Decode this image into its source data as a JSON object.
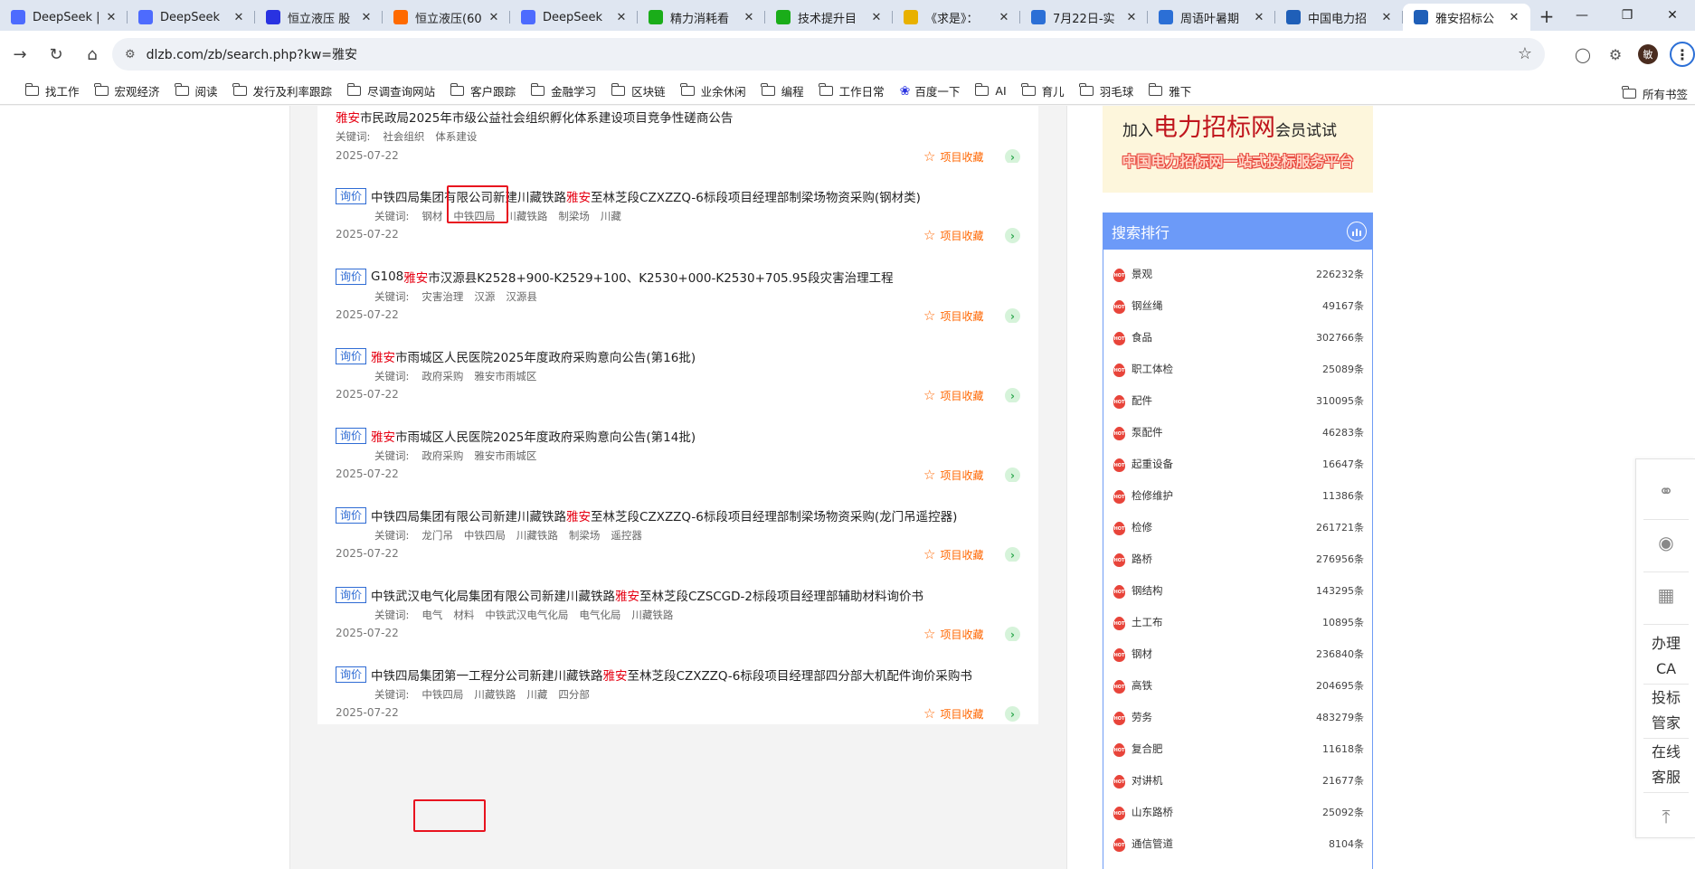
{
  "browser": {
    "tabs": [
      {
        "title": "DeepSeek |",
        "icon": "deepseek-icon",
        "color": "#4d6bfe"
      },
      {
        "title": "DeepSeek",
        "icon": "deepseek-icon",
        "color": "#4d6bfe"
      },
      {
        "title": "恒立液压 股",
        "icon": "baidu-paw-icon",
        "color": "#2932e1"
      },
      {
        "title": "恒立液压(60",
        "icon": "flame-icon",
        "color": "#ff6a00"
      },
      {
        "title": "DeepSeek",
        "icon": "deepseek-icon",
        "color": "#4d6bfe"
      },
      {
        "title": "精力消耗看",
        "icon": "sheet-icon",
        "color": "#1aad19"
      },
      {
        "title": "技术提升目",
        "icon": "sheet-icon",
        "color": "#1aad19"
      },
      {
        "title": "《求是》：",
        "icon": "s-logo-icon",
        "color": "#e8b100"
      },
      {
        "title": "7月22日-实",
        "icon": "doc-icon",
        "color": "#2b6fd6"
      },
      {
        "title": "周语叶暑期",
        "icon": "doc-icon",
        "color": "#2b6fd6"
      },
      {
        "title": "中国电力招",
        "icon": "dlzb-icon",
        "color": "#1f5fb8"
      },
      {
        "title": "雅安招标公",
        "icon": "dlzb-icon",
        "color": "#1f5fb8",
        "active": true
      }
    ],
    "url": "dlzb.com/zb/search.php?kw=雅安",
    "avatar_letter": "敏",
    "bookmarks": [
      "找工作",
      "宏观经济",
      "阅读",
      "发行及利率跟踪",
      "尽调查询网站",
      "客户跟踪",
      "金融学习",
      "区块链",
      "业余休闲",
      "编程",
      "工作日常",
      "百度一下",
      "AI",
      "育儿",
      "羽毛球",
      "雅下"
    ],
    "bookmarks_right": "所有书签"
  },
  "results": {
    "keyword_label": "关键词:",
    "favorite_label": "项目收藏",
    "items": [
      {
        "badge": "",
        "pre": "",
        "hl": "雅安",
        "post": "市民政局2025年市级公益社会组织孵化体系建设项目竞争性磋商公告",
        "keywords": [
          "社会组织",
          "体系建设"
        ],
        "date": "2025-07-22"
      },
      {
        "badge": "询价",
        "pre": "中铁四局集团有限公司新建川藏铁路",
        "hl": "雅安",
        "post": "至林芝段CZXZZQ-6标段项目经理部制梁场物资采购(钢材类)",
        "keywords": [
          "钢材",
          "中铁四局",
          "川藏铁路",
          "制梁场",
          "川藏"
        ],
        "date": "2025-07-22"
      },
      {
        "badge": "询价",
        "pre": "G108",
        "hl": "雅安",
        "post": "市汉源县K2528+900-K2529+100、K2530+000-K2530+705.95段灾害治理工程",
        "keywords": [
          "灾害治理",
          "汉源",
          "汉源县"
        ],
        "date": "2025-07-22"
      },
      {
        "badge": "询价",
        "pre": "",
        "hl": "雅安",
        "post": "市雨城区人民医院2025年度政府采购意向公告(第16批)",
        "keywords": [
          "政府采购",
          "雅安市雨城区"
        ],
        "date": "2025-07-22"
      },
      {
        "badge": "询价",
        "pre": "",
        "hl": "雅安",
        "post": "市雨城区人民医院2025年度政府采购意向公告(第14批)",
        "keywords": [
          "政府采购",
          "雅安市雨城区"
        ],
        "date": "2025-07-22"
      },
      {
        "badge": "询价",
        "pre": "中铁四局集团有限公司新建川藏铁路",
        "hl": "雅安",
        "post": "至林芝段CZXZZQ-6标段项目经理部制梁场物资采购(龙门吊遥控器)",
        "keywords": [
          "龙门吊",
          "中铁四局",
          "川藏铁路",
          "制梁场",
          "遥控器"
        ],
        "date": "2025-07-22"
      },
      {
        "badge": "询价",
        "pre": "中铁武汉电气化局集团有限公司新建川藏铁路",
        "hl": "雅安",
        "post": "至林芝段CZSCGD-2标段项目经理部辅助材料询价书",
        "keywords": [
          "电气",
          "材料",
          "中铁武汉电气化局",
          "电气化局",
          "川藏铁路"
        ],
        "date": "2025-07-22"
      },
      {
        "badge": "询价",
        "pre": "中铁四局集团第一工程分公司新建川藏铁路",
        "hl": "雅安",
        "post": "至林芝段CZXZZQ-6标段项目经理部四分部大机配件询价采购书",
        "keywords": [
          "中铁四局",
          "川藏铁路",
          "川藏",
          "四分部"
        ],
        "date": "2025-07-22"
      }
    ]
  },
  "banner": {
    "line1_pre": "加入",
    "line1_big": "电力招标网",
    "line1_post": "会员试试",
    "line2": "中国电力招标网一站式投标服务平台"
  },
  "ranking": {
    "title": "搜索排行",
    "items": [
      {
        "name": "景观",
        "count": "226232条"
      },
      {
        "name": "钢丝绳",
        "count": "49167条"
      },
      {
        "name": "食品",
        "count": "302766条"
      },
      {
        "name": "职工体检",
        "count": "25089条"
      },
      {
        "name": "配件",
        "count": "310095条"
      },
      {
        "name": "泵配件",
        "count": "46283条"
      },
      {
        "name": "起重设备",
        "count": "16647条"
      },
      {
        "name": "检修维护",
        "count": "11386条"
      },
      {
        "name": "检修",
        "count": "261721条"
      },
      {
        "name": "路桥",
        "count": "276956条"
      },
      {
        "name": "钢结构",
        "count": "143295条"
      },
      {
        "name": "土工布",
        "count": "10895条"
      },
      {
        "name": "钢材",
        "count": "236840条"
      },
      {
        "name": "高铁",
        "count": "204695条"
      },
      {
        "name": "劳务",
        "count": "483279条"
      },
      {
        "name": "复合肥",
        "count": "11618条"
      },
      {
        "name": "对讲机",
        "count": "21677条"
      },
      {
        "name": "山东路桥",
        "count": "25092条"
      },
      {
        "name": "通信管道",
        "count": "8104条"
      }
    ]
  },
  "sidebar": {
    "ca": [
      "办理",
      "CA"
    ],
    "tender": [
      "投标",
      "管家"
    ],
    "service": [
      "在线",
      "客服"
    ]
  },
  "colors": {
    "accent": "#2e6bd4",
    "highlight": "#e60012",
    "favorite": "#ff6600",
    "rank_header": "#6c9af8",
    "annotation": "#e8131f"
  }
}
